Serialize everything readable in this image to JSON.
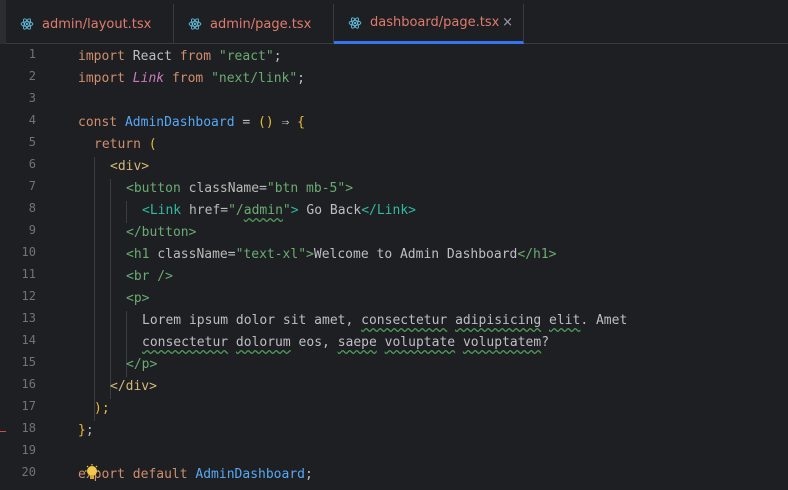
{
  "tabs": [
    {
      "label": "admin/layout.tsx",
      "icon": "react-icon"
    },
    {
      "label": "admin/page.tsx",
      "icon": "react-icon"
    },
    {
      "label": "dashboard/page.tsx",
      "icon": "react-icon",
      "active": true,
      "close": "×"
    }
  ],
  "line_numbers": [
    "1",
    "2",
    "3",
    "4",
    "5",
    "6",
    "7",
    "8",
    "9",
    "10",
    "11",
    "12",
    "13",
    "14",
    "15",
    "16",
    "17",
    "18",
    "19",
    "20"
  ],
  "code": {
    "l1": {
      "a": "import",
      "b": " React ",
      "c": "from",
      "d": " \"react\"",
      "e": ";"
    },
    "l2": {
      "a": "import",
      "b": "Link",
      "c": "from",
      "d": "\"next/link\"",
      "e": ";"
    },
    "l4": {
      "a": "const ",
      "b": "AdminDashboard",
      "c": " = ",
      "d": "()",
      "e": " ⇒ ",
      "f": "{"
    },
    "l5": {
      "a": "return ",
      "b": "("
    },
    "l6": {
      "a": "<div>"
    },
    "l7": {
      "a": "<button ",
      "b": "className",
      "c": "=",
      "d": "\"btn mb-5\"",
      "e": ">"
    },
    "l8": {
      "a": "<",
      "b": "Link",
      "c": " href",
      "d": "=",
      "e": "\"/",
      "f": "admin",
      "g": "\"",
      "h": ">",
      "i": " Go Back",
      "j": "</",
      "k": "Link",
      "l": ">"
    },
    "l9": {
      "a": "</button>"
    },
    "l10": {
      "a": "<h1 ",
      "b": "className",
      "c": "=",
      "d": "\"text-xl\"",
      "e": ">",
      "f": "Welcome to Admin Dashboard",
      "g": "</h1>"
    },
    "l11": {
      "a": "<br />"
    },
    "l12": {
      "a": "<p>"
    },
    "l13": {
      "a": "Lorem ipsum dolor sit amet, ",
      "b": "consectetur",
      "c": " ",
      "d": "adipisicing",
      "e": " ",
      "f": "elit",
      "g": ". Amet"
    },
    "l14": {
      "a": "consectetur",
      "b": " ",
      "c": "dolorum",
      "d": " eos, ",
      "e": "saepe",
      "f": " ",
      "g": "voluptate",
      "h": " ",
      "i": "voluptatem",
      "j": "?"
    },
    "l15": {
      "a": "</p>"
    },
    "l16": {
      "a": "</div>"
    },
    "l17": {
      "a": ");"
    },
    "l18": {
      "a": "}",
      "b": ";"
    },
    "l20": {
      "a": "export default ",
      "b": "AdminDashboard",
      "c": ";"
    }
  },
  "colors": {
    "background": "#1e1f22",
    "tab_text": "#e07b6c",
    "active_underline": "#3574f0"
  }
}
